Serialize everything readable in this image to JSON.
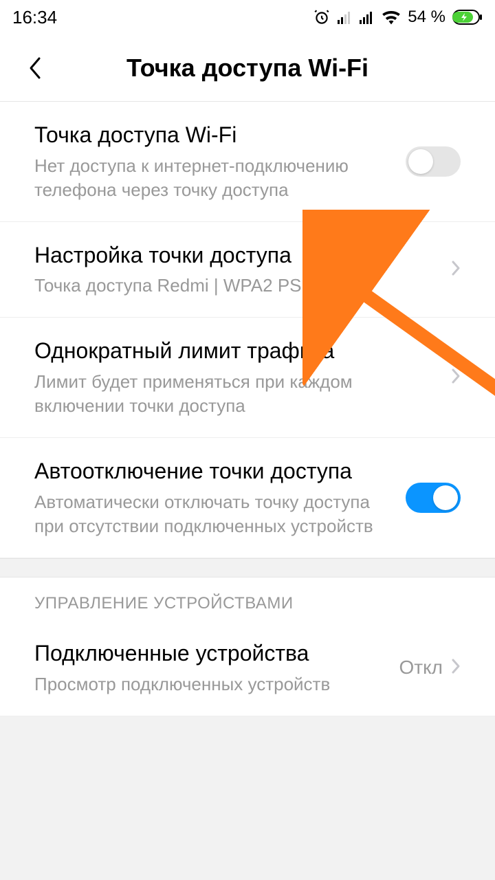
{
  "status": {
    "time": "16:34",
    "battery_text": "54 %"
  },
  "header": {
    "title": "Точка доступа Wi-Fi"
  },
  "rows": {
    "hotspot": {
      "title": "Точка доступа Wi-Fi",
      "subtitle": "Нет доступа к интернет-подключению телефона через точку доступа"
    },
    "setup": {
      "title": "Настройка точки доступа",
      "subtitle": "Точка доступа Redmi | WPA2 PSK"
    },
    "limit": {
      "title": "Однократный лимит трафика",
      "subtitle": "Лимит будет применяться при каждом включении точки доступа"
    },
    "autooff": {
      "title": "Автоотключение точки доступа",
      "subtitle": "Автоматически отключать точку доступа при отсутствии подключенных устройств"
    },
    "devices": {
      "title": "Подключенные устройства",
      "subtitle": "Просмотр подключенных устройств",
      "value": "Откл"
    }
  },
  "section": {
    "devices_header": "УПРАВЛЕНИЕ УСТРОЙСТВАМИ"
  }
}
